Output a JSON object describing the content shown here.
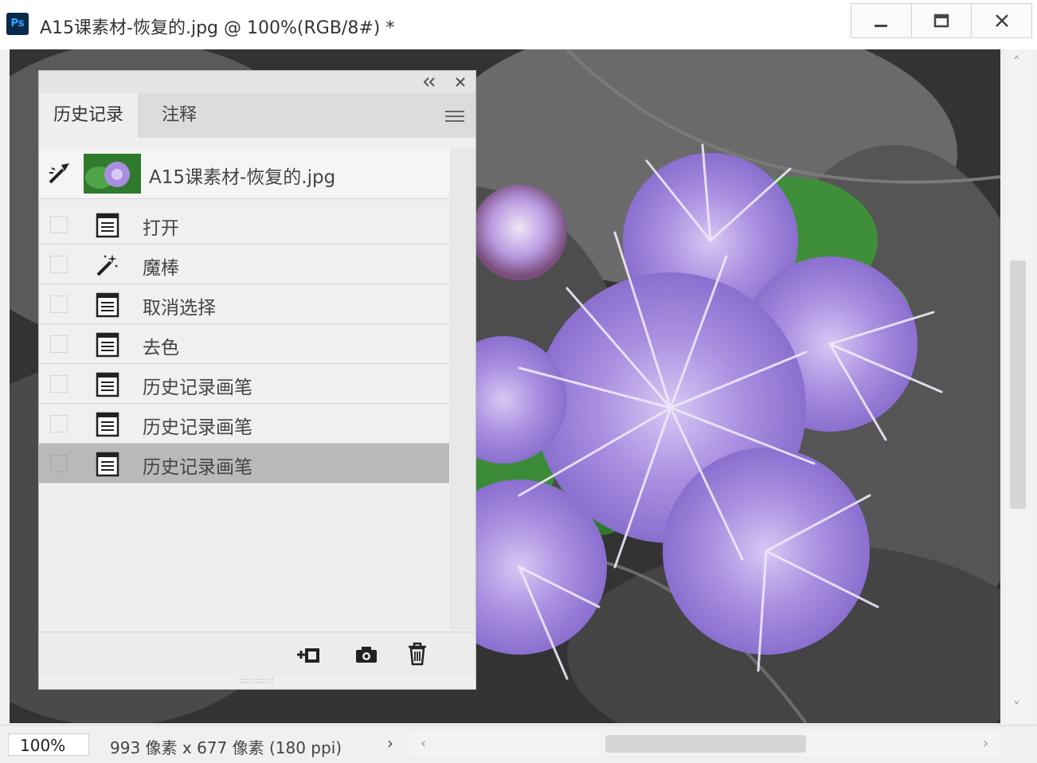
{
  "window": {
    "app_icon": "Ps",
    "title": "A15课素材-恢复的.jpg @ 100%(RGB/8#) *",
    "minimize_icon": "minimize-icon",
    "maximize_icon": "maximize-icon",
    "close_icon": "close-icon"
  },
  "history_panel": {
    "tabs": [
      {
        "label": "历史记录",
        "active": true
      },
      {
        "label": "注释",
        "active": false
      }
    ],
    "snapshot": {
      "label": "A15课素材-恢复的.jpg",
      "icon": "history-brush-source-icon"
    },
    "states": [
      {
        "label": "打开",
        "icon": "document-icon",
        "selected": false
      },
      {
        "label": "魔棒",
        "icon": "magic-wand-icon",
        "selected": false
      },
      {
        "label": "取消选择",
        "icon": "document-icon",
        "selected": false
      },
      {
        "label": "去色",
        "icon": "document-icon",
        "selected": false
      },
      {
        "label": "历史记录画笔",
        "icon": "document-icon",
        "selected": false
      },
      {
        "label": "历史记录画笔",
        "icon": "document-icon",
        "selected": false
      },
      {
        "label": "历史记录画笔",
        "icon": "document-icon",
        "selected": true
      }
    ],
    "bottom_icons": [
      "new-document-from-state-icon",
      "camera-icon",
      "trash-icon"
    ]
  },
  "status_bar": {
    "zoom": "100%",
    "doc_info": "993 像素 x 677 像素 (180 ppi)",
    "arrow": "›"
  },
  "colors": {
    "selected_row": "#b9b9b9",
    "flower_purple": "#a98ee0",
    "leaf_green": "#3f8f3a",
    "ps_blue": "#31a8ff"
  }
}
